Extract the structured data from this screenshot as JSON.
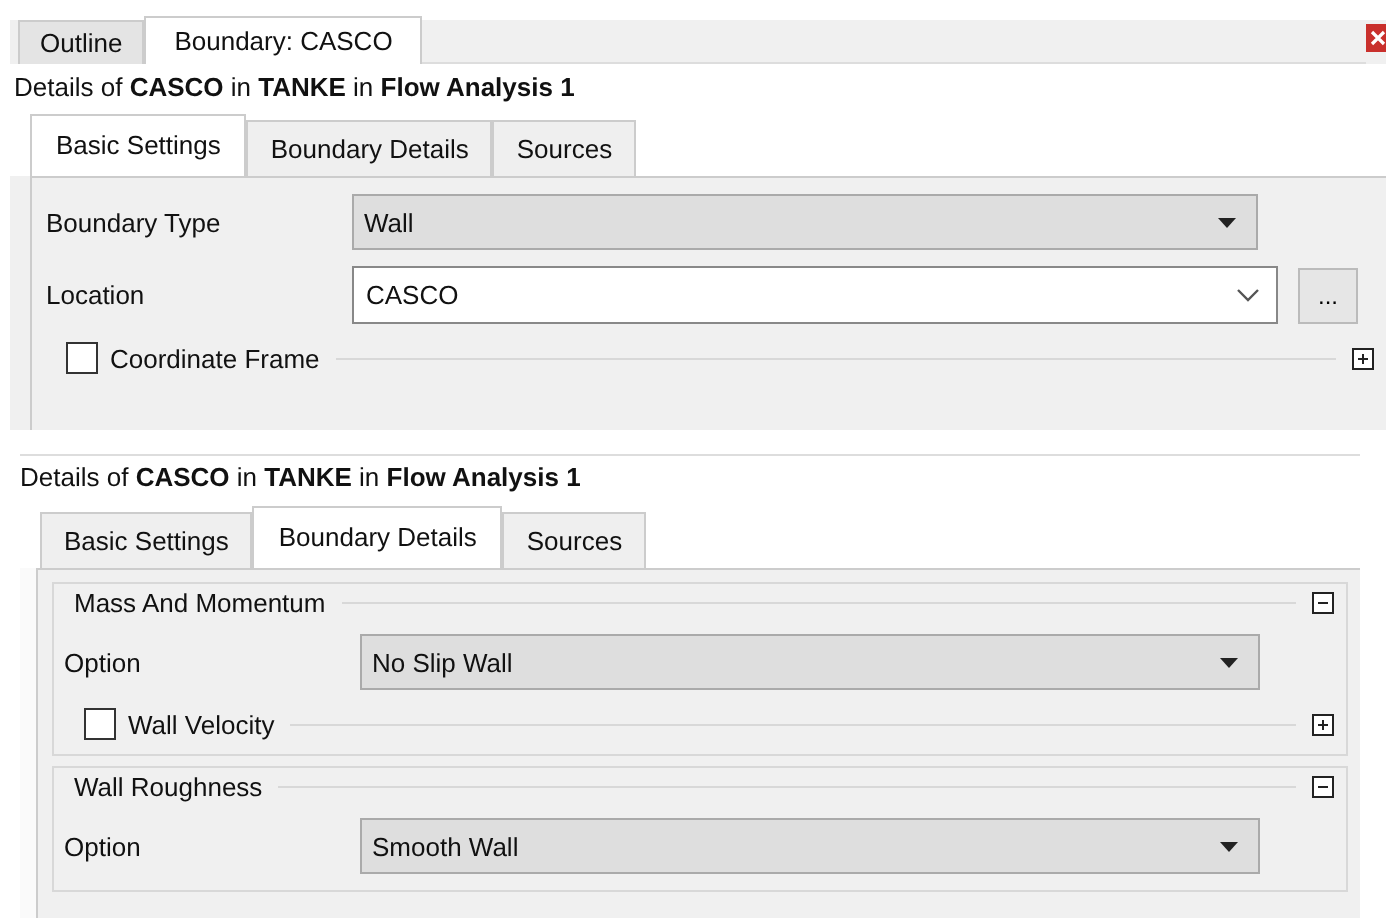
{
  "panels": [
    {
      "top_tabs": [
        {
          "label": "Outline",
          "selected": false
        },
        {
          "label": "Boundary: CASCO",
          "selected": true
        }
      ],
      "close_button": true,
      "heading": "Details of **CASCO** in **TANKE** in **Flow Analysis 1**",
      "tabs": [
        {
          "label": "Basic Settings",
          "selected": true
        },
        {
          "label": "Boundary Details",
          "selected": false
        },
        {
          "label": "Sources",
          "selected": false
        }
      ],
      "items": [
        {
          "kind": "dropdown",
          "label": "Boundary Type",
          "value": "Wall"
        },
        {
          "kind": "combo",
          "label": "Location",
          "value": "CASCO",
          "button": "..."
        },
        {
          "kind": "group",
          "title": "Coordinate Frame",
          "checked": false,
          "expanded": false
        }
      ]
    },
    {
      "heading": "Details of **CASCO** in **TANKE** in **Flow Analysis 1**",
      "tabs": [
        {
          "label": "Basic Settings",
          "selected": false
        },
        {
          "label": "Boundary Details",
          "selected": true
        },
        {
          "label": "Sources",
          "selected": false
        }
      ],
      "items": [
        {
          "kind": "group",
          "title": "Mass And Momentum",
          "expanded": true,
          "children": [
            {
              "kind": "dropdown",
              "label": "Option",
              "value": "No Slip Wall"
            },
            {
              "kind": "group",
              "title": "Wall Velocity",
              "checked": false,
              "expanded": false
            }
          ]
        },
        {
          "kind": "group",
          "title": "Wall Roughness",
          "expanded": true,
          "children": [
            {
              "kind": "dropdown",
              "label": "Option",
              "value": "Smooth Wall"
            }
          ]
        }
      ]
    }
  ]
}
